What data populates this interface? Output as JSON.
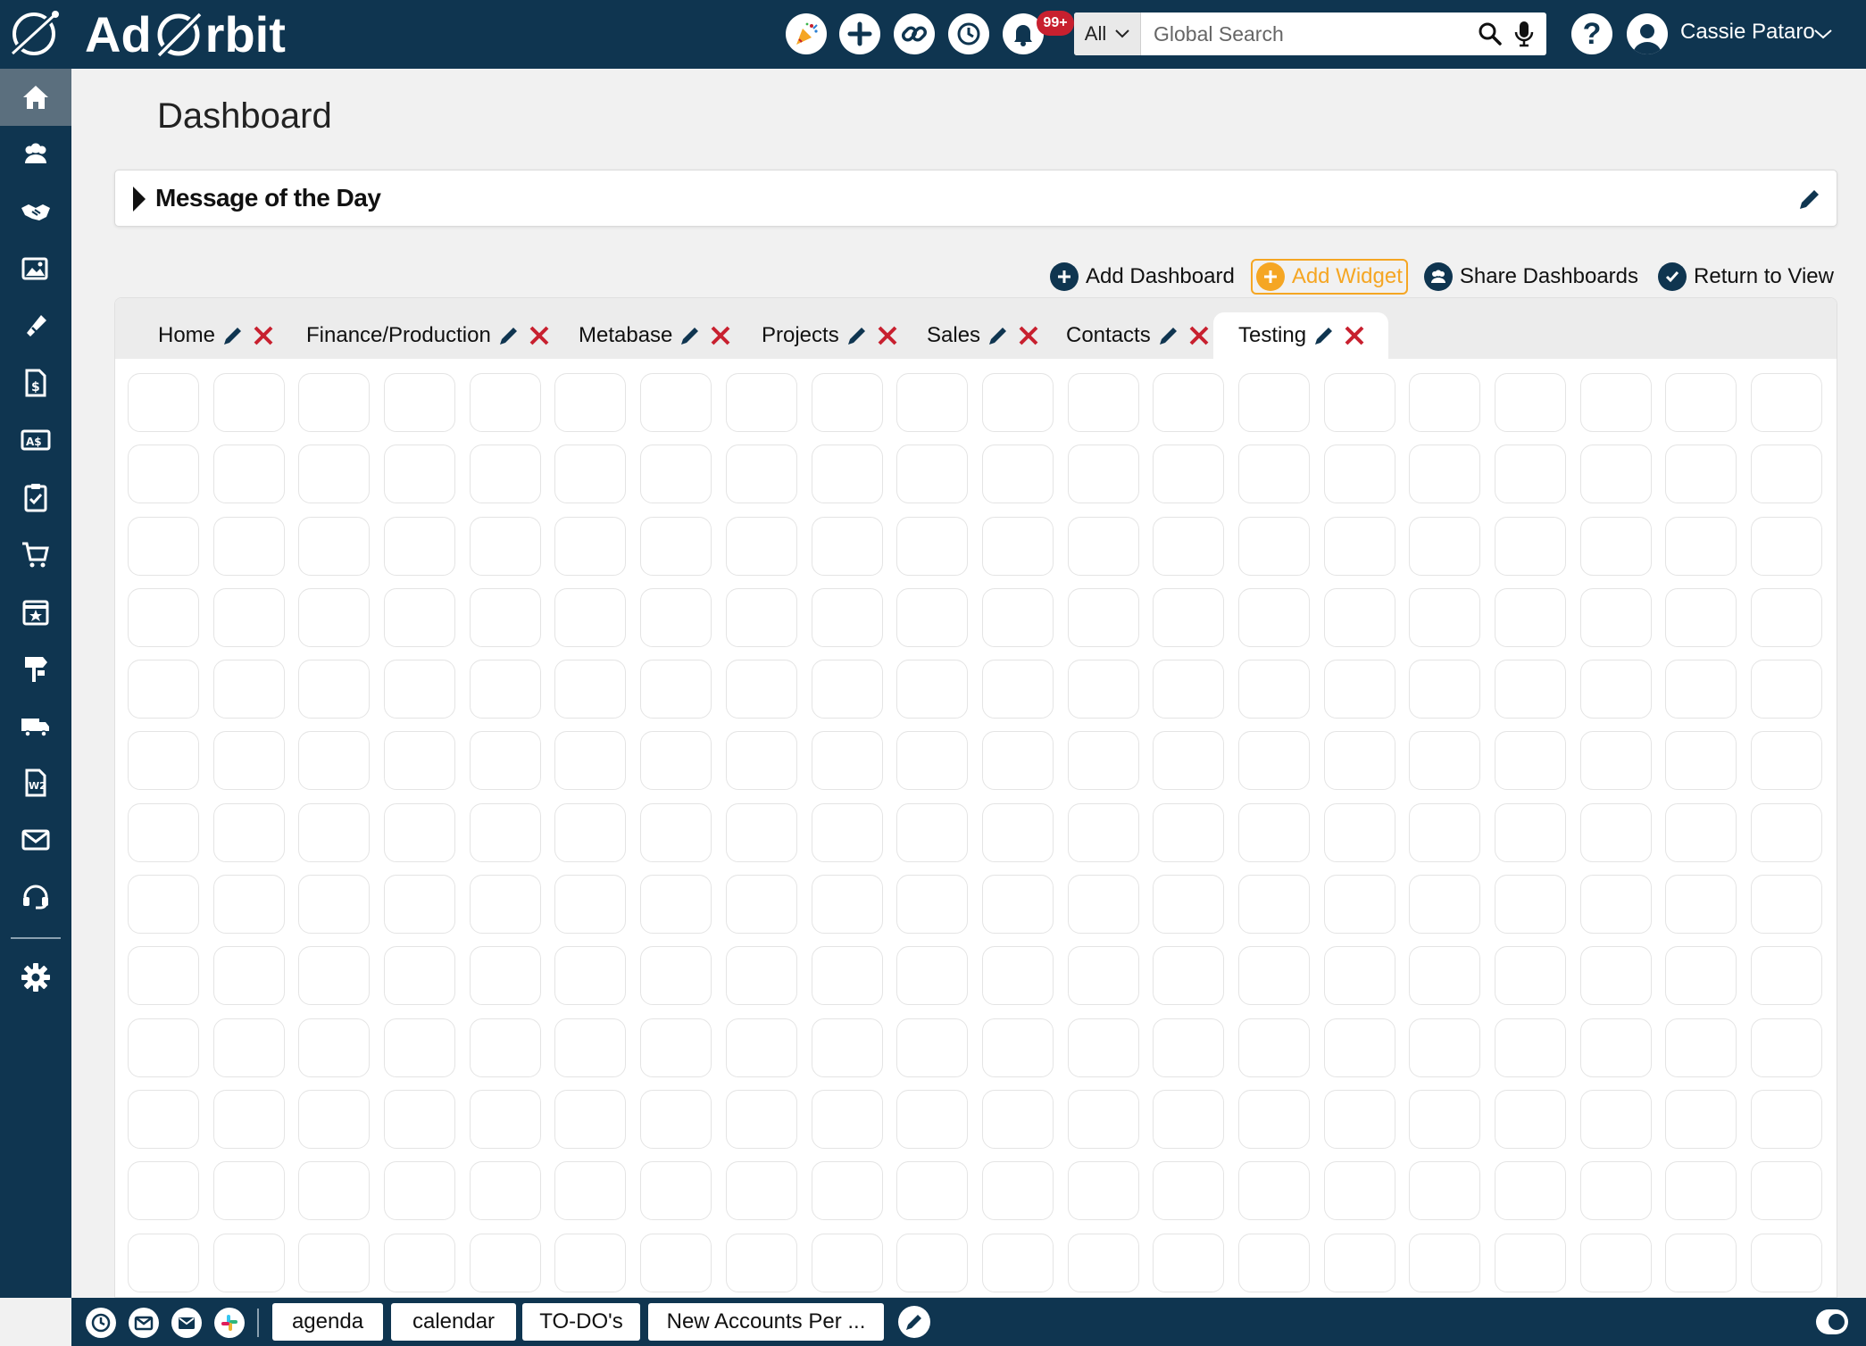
{
  "app": {
    "name_prefix": "Ad",
    "name_suffix": "rbit",
    "brand_color": "#0f3550",
    "accent_color": "#f5a623",
    "danger_color": "#c8202f"
  },
  "header": {
    "icons": [
      "party-icon",
      "plus-icon",
      "link-icon",
      "history-icon",
      "bell-icon"
    ],
    "notification_count": "99+",
    "search": {
      "scope": "All",
      "placeholder": "Global Search"
    },
    "help_label": "?",
    "user_name": "Cassie Pataro"
  },
  "sidebar": {
    "items": [
      {
        "icon": "home-icon",
        "active": true
      },
      {
        "icon": "contacts-icon"
      },
      {
        "icon": "handshake-icon"
      },
      {
        "icon": "media-icon"
      },
      {
        "icon": "ad-icon"
      },
      {
        "icon": "invoice-icon"
      },
      {
        "icon": "currency-icon"
      },
      {
        "icon": "clipboard-icon"
      },
      {
        "icon": "cart-icon"
      },
      {
        "icon": "calendar-star-icon"
      },
      {
        "icon": "signpost-icon"
      },
      {
        "icon": "truck-icon"
      },
      {
        "icon": "w2-icon"
      },
      {
        "icon": "mail-icon"
      },
      {
        "icon": "support-icon"
      },
      {
        "icon": "settings-icon"
      }
    ]
  },
  "main": {
    "title": "Dashboard",
    "motd_title": "Message of the Day",
    "actions": {
      "add_dashboard": "Add Dashboard",
      "add_widget": "Add Widget",
      "share_dashboards": "Share Dashboards",
      "return_to_view": "Return to View"
    },
    "tabs": [
      {
        "label": "Home"
      },
      {
        "label": "Finance/Production"
      },
      {
        "label": "Metabase"
      },
      {
        "label": "Projects"
      },
      {
        "label": "Sales"
      },
      {
        "label": "Contacts"
      },
      {
        "label": "Testing",
        "active": true
      }
    ],
    "grid": {
      "columns": 20,
      "rows": 13
    }
  },
  "bottombar": {
    "icons": [
      "history-icon",
      "mail-icon",
      "envelope-icon",
      "slack-icon"
    ],
    "buttons": [
      "agenda",
      "calendar",
      "TO-DO's",
      "New Accounts Per ..."
    ]
  }
}
